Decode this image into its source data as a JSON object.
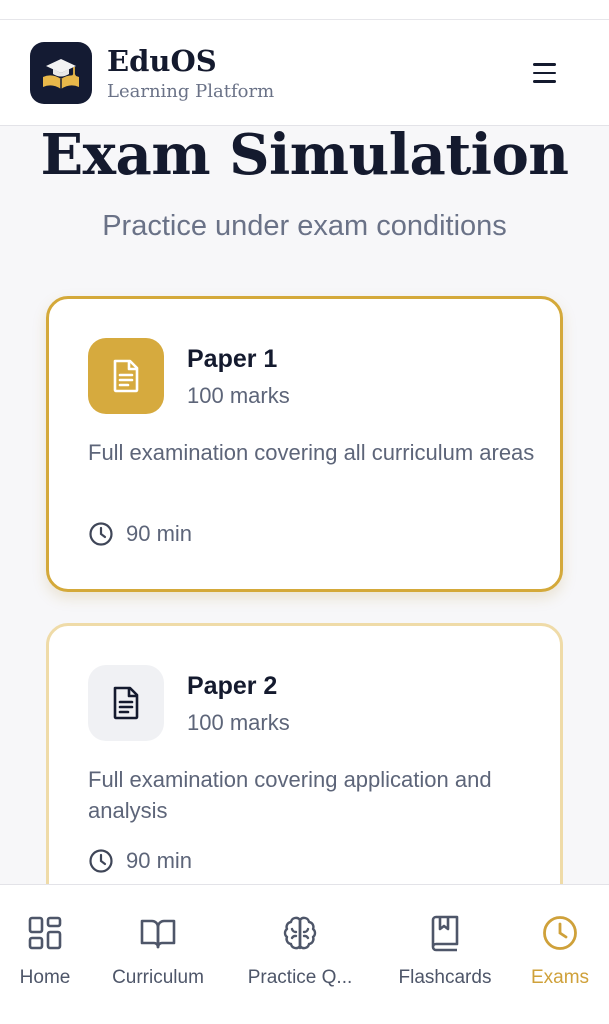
{
  "header": {
    "brand_name": "EduOS",
    "brand_subtitle": "Learning Platform",
    "logo_icon": "graduation-cap-book-icon",
    "menu_icon": "hamburger-menu-icon"
  },
  "page": {
    "title": "Exam Simulation",
    "subtitle": "Practice under exam conditions"
  },
  "papers": [
    {
      "title": "Paper 1",
      "marks": "100 marks",
      "description": "Full examination covering all curriculum areas",
      "duration": "90 min",
      "selected": true
    },
    {
      "title": "Paper 2",
      "marks": "100 marks",
      "description": "Full examination covering application and analysis",
      "duration": "90 min",
      "selected": false
    }
  ],
  "nav": {
    "items": [
      {
        "label": "Home",
        "icon": "grid-icon"
      },
      {
        "label": "Curriculum",
        "icon": "book-open-icon"
      },
      {
        "label": "Practice Q...",
        "icon": "brain-icon"
      },
      {
        "label": "Flashcards",
        "icon": "bookmark-book-icon"
      },
      {
        "label": "Exams",
        "icon": "clock-icon"
      }
    ],
    "active": "Exams"
  },
  "colors": {
    "accent": "#d4a93a",
    "dark": "#141a2e",
    "muted": "#6a7287"
  }
}
